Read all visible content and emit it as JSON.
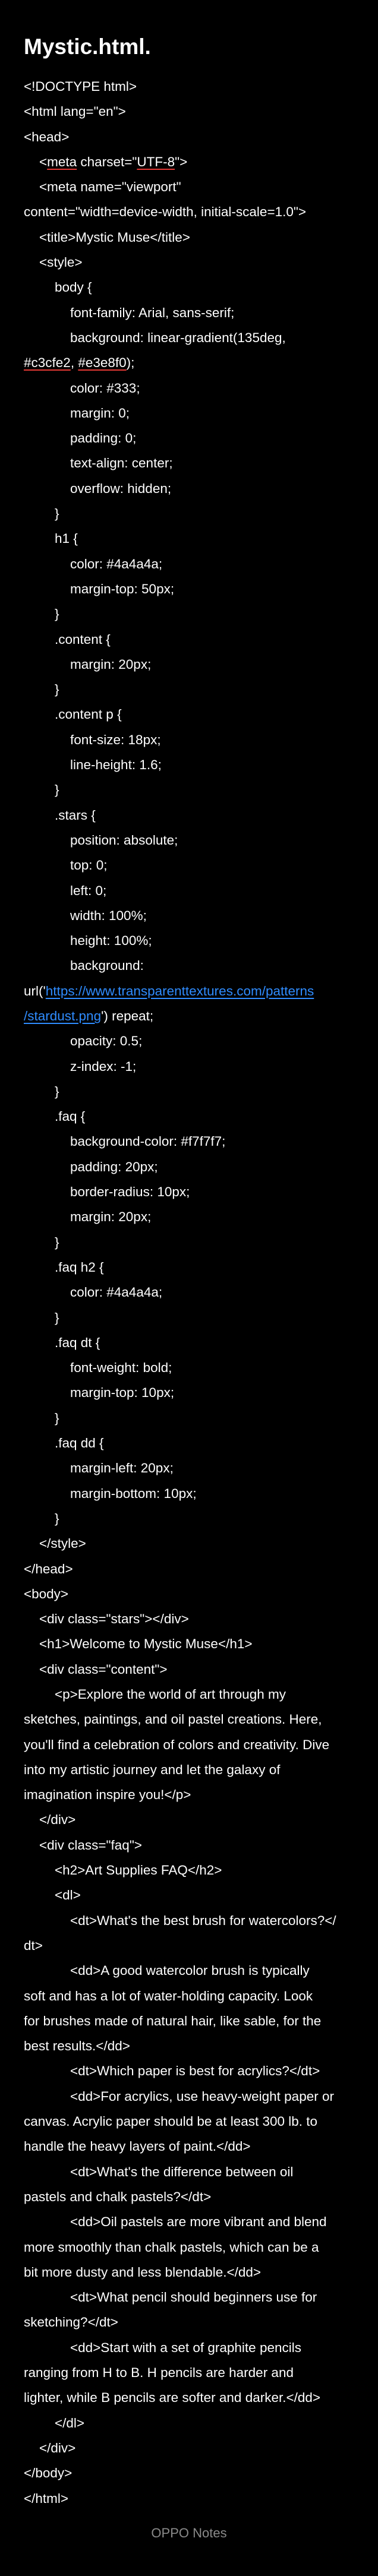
{
  "note": {
    "title": "Mystic.html.",
    "footer": "OPPO Notes"
  },
  "lines": [
    {
      "t": "<!DOCTYPE html>",
      "i": 0
    },
    {
      "t": "<html lang=\"en\">",
      "i": 0
    },
    {
      "t": "<head>",
      "i": 0
    },
    {
      "t": "<meta charset=\"UTF-8\">",
      "i": 1,
      "u": [
        "meta",
        "UTF-8"
      ]
    },
    {
      "t": "<meta name=\"viewport\"",
      "i": 1
    },
    {
      "t": "content=\"width=device-width, initial-scale=1.0\">",
      "i": 0
    },
    {
      "t": "<title>Mystic Muse</title>",
      "i": 1
    },
    {
      "t": "<style>",
      "i": 1
    },
    {
      "t": "body {",
      "i": 2
    },
    {
      "t": "font-family: Arial, sans-serif;",
      "i": 3
    },
    {
      "t": "background: linear-gradient(135deg,",
      "i": 3
    },
    {
      "t": "#c3cfe2, #e3e8f0);",
      "i": 0,
      "u": [
        "#c3cfe2",
        "#e3e8f0"
      ]
    },
    {
      "t": "color: #333;",
      "i": 3
    },
    {
      "t": "margin: 0;",
      "i": 3
    },
    {
      "t": "padding: 0;",
      "i": 3
    },
    {
      "t": "text-align: center;",
      "i": 3
    },
    {
      "t": "overflow: hidden;",
      "i": 3
    },
    {
      "t": "}",
      "i": 2
    },
    {
      "t": "h1 {",
      "i": 2
    },
    {
      "t": "color: #4a4a4a;",
      "i": 3
    },
    {
      "t": "margin-top: 50px;",
      "i": 3
    },
    {
      "t": "}",
      "i": 2
    },
    {
      "t": ".content {",
      "i": 2
    },
    {
      "t": "margin: 20px;",
      "i": 3
    },
    {
      "t": "}",
      "i": 2
    },
    {
      "t": ".content p {",
      "i": 2
    },
    {
      "t": "font-size: 18px;",
      "i": 3
    },
    {
      "t": "line-height: 1.6;",
      "i": 3
    },
    {
      "t": "}",
      "i": 2
    },
    {
      "t": ".stars {",
      "i": 2
    },
    {
      "t": "position: absolute;",
      "i": 3
    },
    {
      "t": "top: 0;",
      "i": 3
    },
    {
      "t": "left: 0;",
      "i": 3
    },
    {
      "t": "width: 100%;",
      "i": 3
    },
    {
      "t": "height: 100%;",
      "i": 3
    },
    {
      "t": "background:",
      "i": 3
    },
    {
      "t": "url('https://www.transparenttextures.com/patterns",
      "i": 0,
      "link": "https://www.transparenttextures.com/patterns",
      "prefix": "url('"
    },
    {
      "t": "/stardust.png') repeat;",
      "i": 0,
      "link": "/stardust.png",
      "suffix": "') repeat;"
    },
    {
      "t": "opacity: 0.5;",
      "i": 3
    },
    {
      "t": "z-index: -1;",
      "i": 3
    },
    {
      "t": "}",
      "i": 2
    },
    {
      "t": ".faq {",
      "i": 2
    },
    {
      "t": "background-color: #f7f7f7;",
      "i": 3
    },
    {
      "t": "padding: 20px;",
      "i": 3
    },
    {
      "t": "border-radius: 10px;",
      "i": 3
    },
    {
      "t": "margin: 20px;",
      "i": 3
    },
    {
      "t": "}",
      "i": 2
    },
    {
      "t": ".faq h2 {",
      "i": 2
    },
    {
      "t": "color: #4a4a4a;",
      "i": 3
    },
    {
      "t": "}",
      "i": 2
    },
    {
      "t": ".faq dt {",
      "i": 2
    },
    {
      "t": "font-weight: bold;",
      "i": 3
    },
    {
      "t": "margin-top: 10px;",
      "i": 3
    },
    {
      "t": "}",
      "i": 2
    },
    {
      "t": ".faq dd {",
      "i": 2
    },
    {
      "t": "margin-left: 20px;",
      "i": 3
    },
    {
      "t": "margin-bottom: 10px;",
      "i": 3
    },
    {
      "t": "}",
      "i": 2
    },
    {
      "t": "</style>",
      "i": 1
    },
    {
      "t": "</head>",
      "i": 0
    },
    {
      "t": "<body>",
      "i": 0
    },
    {
      "t": "<div class=\"stars\"></div>",
      "i": 1
    },
    {
      "t": "<h1>Welcome to Mystic Muse</h1>",
      "i": 1
    },
    {
      "t": "<div class=\"content\">",
      "i": 1
    },
    {
      "t": "<p>Explore the world of art through my",
      "i": 2
    },
    {
      "t": "sketches, paintings, and oil pastel creations. Here,",
      "i": 0
    },
    {
      "t": "you'll find a celebration of colors and creativity. Dive",
      "i": 0
    },
    {
      "t": "into my artistic journey and let the galaxy of",
      "i": 0
    },
    {
      "t": "imagination inspire you!</p>",
      "i": 0
    },
    {
      "t": "</div>",
      "i": 1
    },
    {
      "t": "<div class=\"faq\">",
      "i": 1
    },
    {
      "t": "<h2>Art Supplies FAQ</h2>",
      "i": 2
    },
    {
      "t": "<dl>",
      "i": 2
    },
    {
      "t": "<dt>What's the best brush for watercolors?</",
      "i": 3
    },
    {
      "t": "dt>",
      "i": 0
    },
    {
      "t": "<dd>A good watercolor brush is typically",
      "i": 3
    },
    {
      "t": "soft and has a lot of water-holding capacity. Look",
      "i": 0
    },
    {
      "t": "for brushes made of natural hair, like sable, for the",
      "i": 0
    },
    {
      "t": "best results.</dd>",
      "i": 0
    },
    {
      "t": "<dt>Which paper is best for acrylics?</dt>",
      "i": 3
    },
    {
      "t": "<dd>For acrylics, use heavy-weight paper or",
      "i": 3
    },
    {
      "t": "canvas. Acrylic paper should be at least 300 lb. to",
      "i": 0
    },
    {
      "t": "handle the heavy layers of paint.</dd>",
      "i": 0
    },
    {
      "t": "<dt>What's the difference between oil",
      "i": 3
    },
    {
      "t": "pastels and chalk pastels?</dt>",
      "i": 0
    },
    {
      "t": "<dd>Oil pastels are more vibrant and blend",
      "i": 3
    },
    {
      "t": "more smoothly than chalk pastels, which can be a",
      "i": 0
    },
    {
      "t": "bit more dusty and less blendable.</dd>",
      "i": 0
    },
    {
      "t": "<dt>What pencil should beginners use for",
      "i": 3
    },
    {
      "t": "sketching?</dt>",
      "i": 0
    },
    {
      "t": "<dd>Start with a set of graphite pencils",
      "i": 3
    },
    {
      "t": "ranging from H to B. H pencils are harder and",
      "i": 0
    },
    {
      "t": "lighter, while B pencils are softer and darker.</dd>",
      "i": 0
    },
    {
      "t": "</dl>",
      "i": 2
    },
    {
      "t": "</div>",
      "i": 1
    },
    {
      "t": "</body>",
      "i": 0
    },
    {
      "t": "</html>",
      "i": 0
    }
  ]
}
